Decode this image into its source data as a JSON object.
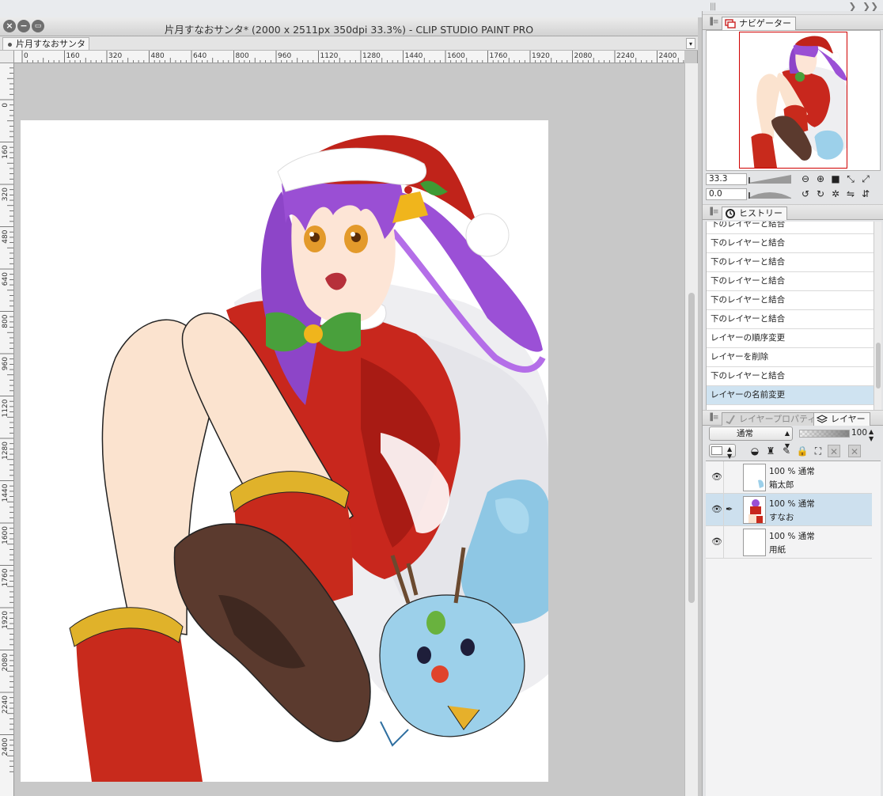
{
  "window": {
    "title": "片月すなおサンタ* (2000 x 2511px 350dpi 33.3%)  - CLIP STUDIO PAINT PRO",
    "tab_label": "片月すなおサンタ*",
    "close_glyph": "×",
    "minimize_glyph": "−"
  },
  "rulers": {
    "horizontal": [
      "0",
      "160",
      "320",
      "480",
      "640",
      "800",
      "960",
      "1120",
      "1280",
      "1440",
      "1600",
      "1760",
      "1920",
      "2080",
      "2240",
      "2400"
    ],
    "vertical": [
      "160",
      "0",
      "160",
      "320",
      "480",
      "640",
      "800",
      "960",
      "1120",
      "1280",
      "1440",
      "1600",
      "1760",
      "1920",
      "2080",
      "2240",
      "2400"
    ]
  },
  "navigator": {
    "tab_label": "ナビゲーター",
    "zoom": "33.3",
    "rotation": "0.0"
  },
  "history": {
    "tab_label": "ヒストリー",
    "items": [
      "下のレイヤーと結合",
      "下のレイヤーと結合",
      "下のレイヤーと結合",
      "下のレイヤーと結合",
      "下のレイヤーと結合",
      "下のレイヤーと結合",
      "レイヤーの順序変更",
      "レイヤーを削除",
      "下のレイヤーと結合",
      "レイヤーの名前変更"
    ],
    "selected_index": 9
  },
  "layer_panel": {
    "tabs": [
      "レイヤープロパティ",
      "レイヤー"
    ],
    "blend_mode": "通常",
    "opacity": "100",
    "layers": [
      {
        "mode": "100 % 通常",
        "name": "箱太郎",
        "selected": false
      },
      {
        "mode": "100 % 通常",
        "name": "すなお",
        "selected": true
      },
      {
        "mode": "100 % 通常",
        "name": "用紙",
        "selected": false
      }
    ]
  },
  "icons": {
    "eye": "eye-icon",
    "brush": "brush-icon",
    "zoom_out": "zoom-out-icon",
    "zoom_in": "zoom-in-icon"
  },
  "colors": {
    "canvas_bg": "#c8c8c8",
    "selection": "#cde0ee",
    "navigator_frame": "#d00000"
  }
}
